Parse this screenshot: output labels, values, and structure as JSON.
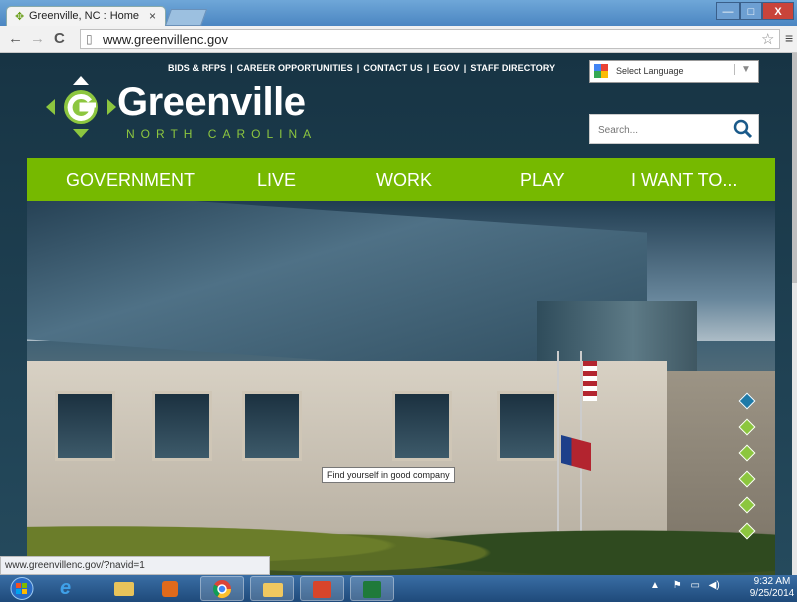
{
  "browser": {
    "tab_title": "Greenville, NC : Home",
    "tab_close": "×",
    "url": "www.greenvillenc.gov",
    "window_controls": {
      "minimize": "—",
      "maximize": "□",
      "close": "X"
    }
  },
  "site": {
    "top_links": [
      "BIDS & RFPS",
      "CAREER OPPORTUNITIES",
      "CONTACT US",
      "EGOV",
      "STAFF DIRECTORY"
    ],
    "top_links_separator": "|",
    "language_select": "Select Language",
    "search_placeholder": "Search...",
    "logo": {
      "name": "Greenville",
      "sub": "NORTH CAROLINA"
    },
    "nav": [
      "GOVERNMENT",
      "LIVE",
      "WORK",
      "PLAY",
      "I WANT TO..."
    ],
    "hero_tooltip": "Find yourself in good company",
    "accent_color": "#76b900"
  },
  "status_bar": "www.greenvillenc.gov/?navid=1",
  "taskbar": {
    "apps": [
      "internet-explorer-icon",
      "file-explorer-icon",
      "media-player-icon",
      "chrome-icon",
      "folder-icon",
      "outlook-icon",
      "excel-icon"
    ],
    "time": "9:32 AM",
    "date": "9/25/2014"
  }
}
